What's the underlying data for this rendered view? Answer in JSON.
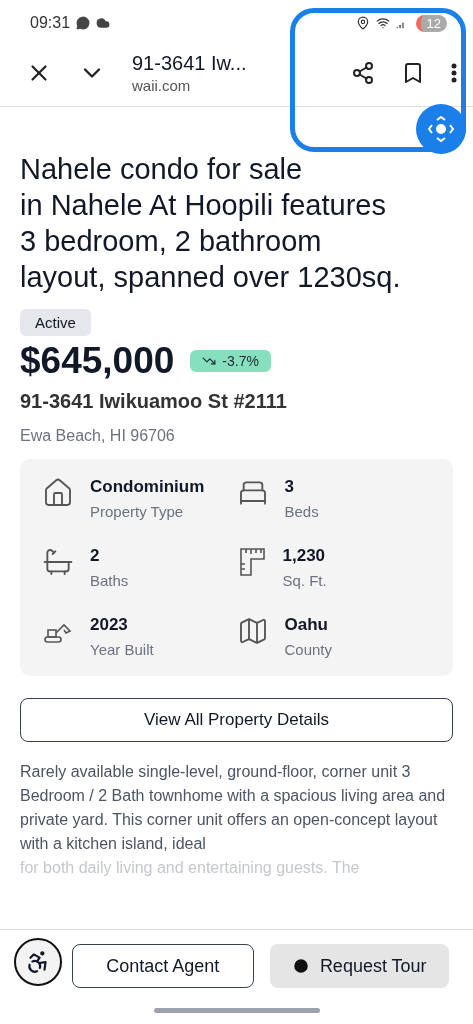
{
  "status_bar": {
    "time": "09:31",
    "battery": "12"
  },
  "browser_toolbar": {
    "title": "91-3641 Iw...",
    "url": "waii.com"
  },
  "listing": {
    "heading_lines": [
      "Nahele condo for sale",
      "in Nahele At Hoopili features",
      "3 bedroom, 2 bathroom",
      "layout, spanned over 1230sq."
    ],
    "status": "Active",
    "price": "$645,000",
    "change": "-3.7%",
    "address": "91-3641 Iwikuamoo St #2111",
    "city": "Ewa Beach, HI 96706"
  },
  "details": [
    {
      "value": "Condominium",
      "label": "Property Type"
    },
    {
      "value": "3",
      "label": "Beds"
    },
    {
      "value": "2",
      "label": "Baths"
    },
    {
      "value": "1,230",
      "label": "Sq. Ft."
    },
    {
      "value": "2023",
      "label": "Year Built"
    },
    {
      "value": "Oahu",
      "label": "County"
    }
  ],
  "details_button": "View All Property Details",
  "description": "Rarely available single-level, ground-floor, corner unit 3 Bedroom / 2 Bath townhome with a spacious living area and private yard. This corner unit offers an open-concept layout with a kitchen island, ideal",
  "description_faded": "for both daily living and entertaining guests. The",
  "actions": [
    {
      "label": "Contact Agent",
      "kind": "outline"
    },
    {
      "label": "Request Tour",
      "kind": "filled"
    }
  ]
}
